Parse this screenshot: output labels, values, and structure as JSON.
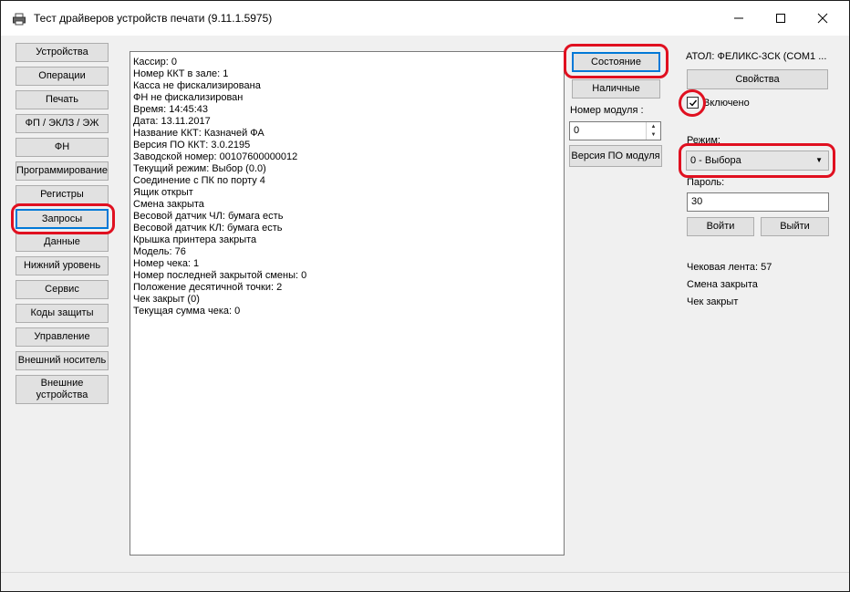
{
  "window": {
    "title": "Тест драйверов устройств печати (9.11.1.5975)",
    "icons": {
      "app": "printer-icon",
      "minimize": "minimize-icon",
      "maximize": "maximize-icon",
      "close": "close-icon"
    }
  },
  "nav": {
    "items": [
      {
        "label": "Устройства"
      },
      {
        "label": "Операции"
      },
      {
        "label": "Печать"
      },
      {
        "label": "ФП / ЭКЛЗ / ЭЖ"
      },
      {
        "label": "ФН"
      },
      {
        "label": "Программирование"
      },
      {
        "label": "Регистры"
      },
      {
        "label": "Запросы"
      },
      {
        "label": "Данные"
      },
      {
        "label": "Нижний уровень"
      },
      {
        "label": "Сервис"
      },
      {
        "label": "Коды защиты"
      },
      {
        "label": "Управление"
      },
      {
        "label": "Внешний носитель"
      },
      {
        "label": "Внешние устройства"
      }
    ],
    "selected": "Запросы"
  },
  "output": {
    "lines": [
      "Кассир: 0",
      "Номер ККТ в зале: 1",
      "Касса не фискализирована",
      "ФН не фискализирован",
      "Время: 14:45:43",
      "Дата: 13.11.2017",
      "Название ККТ: Казначей ФА",
      "Версия ПО ККТ: 3.0.2195",
      "Заводской номер: 00107600000012",
      "Текущий режим: Выбор (0.0)",
      "Соединение с ПК по порту 4",
      "Ящик открыт",
      "Смена закрыта",
      "Весовой датчик ЧЛ: бумага есть",
      "Весовой датчик КЛ: бумага есть",
      "Крышка принтера закрыта",
      "Модель: 76",
      "Номер чека: 1",
      "Номер последней закрытой смены: 0",
      "Положение десятичной точки: 2",
      "Чек закрыт (0)",
      "Текущая сумма чека: 0"
    ]
  },
  "middle": {
    "state_button": "Состояние",
    "cash_button": "Наличные",
    "module_label": "Номер модуля :",
    "module_value": "0",
    "module_version_button": "Версия ПО модуля"
  },
  "device": {
    "name": "АТОЛ: ФЕЛИКС-3СК (COM1 ...",
    "properties_button": "Свойства",
    "enabled_label": "Включено",
    "enabled_checked": true,
    "mode_label": "Режим:",
    "mode_value": "0 - Выбора",
    "password_label": "Пароль:",
    "password_value": "30",
    "login_button": "Войти",
    "logout_button": "Выйти",
    "status": [
      "Чековая лента: 57",
      "Смена закрыта",
      "Чек закрыт"
    ]
  },
  "colors": {
    "highlight": "#e01020",
    "selection": "#0078d7"
  }
}
